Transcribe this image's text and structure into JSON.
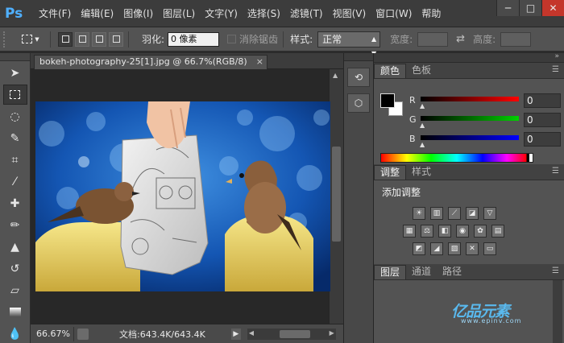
{
  "app": {
    "logo": "Ps"
  },
  "menu": [
    "文件(F)",
    "编辑(E)",
    "图像(I)",
    "图层(L)",
    "文字(Y)",
    "选择(S)",
    "滤镜(T)",
    "视图(V)",
    "窗口(W)",
    "帮助"
  ],
  "window_controls": {
    "minimize": "─",
    "maximize": "□",
    "close": "✕"
  },
  "options": {
    "tool_icon": "marquee-icon",
    "feather_label": "羽化:",
    "feather_value": "0 像素",
    "anti_alias_label": "消除锯齿",
    "style_label": "样式:",
    "style_value": "正常",
    "width_label": "宽度:",
    "height_label": "高度:"
  },
  "document": {
    "tab_title": "bokeh-photography-25[1].jpg @ 66.7%(RGB/8)",
    "close": "×"
  },
  "status": {
    "zoom": "66.67%",
    "doc_info": "文档:643.4K/643.4K",
    "arrow": "▶"
  },
  "color_panel": {
    "tabs": [
      "颜色",
      "色板"
    ],
    "sliders": [
      {
        "label": "R",
        "value": "0",
        "color": "#ff0000"
      },
      {
        "label": "G",
        "value": "0",
        "color": "#00c000"
      },
      {
        "label": "B",
        "value": "0",
        "color": "#0000ff"
      }
    ],
    "foreground": "#000000",
    "background": "#ffffff"
  },
  "adjust_panel": {
    "tabs": [
      "调整",
      "样式"
    ],
    "title": "添加调整"
  },
  "layers_panel": {
    "tabs": [
      "图层",
      "通道",
      "路径"
    ]
  },
  "watermark": {
    "text": "亿品元素",
    "sub": "www.epinv.com"
  }
}
